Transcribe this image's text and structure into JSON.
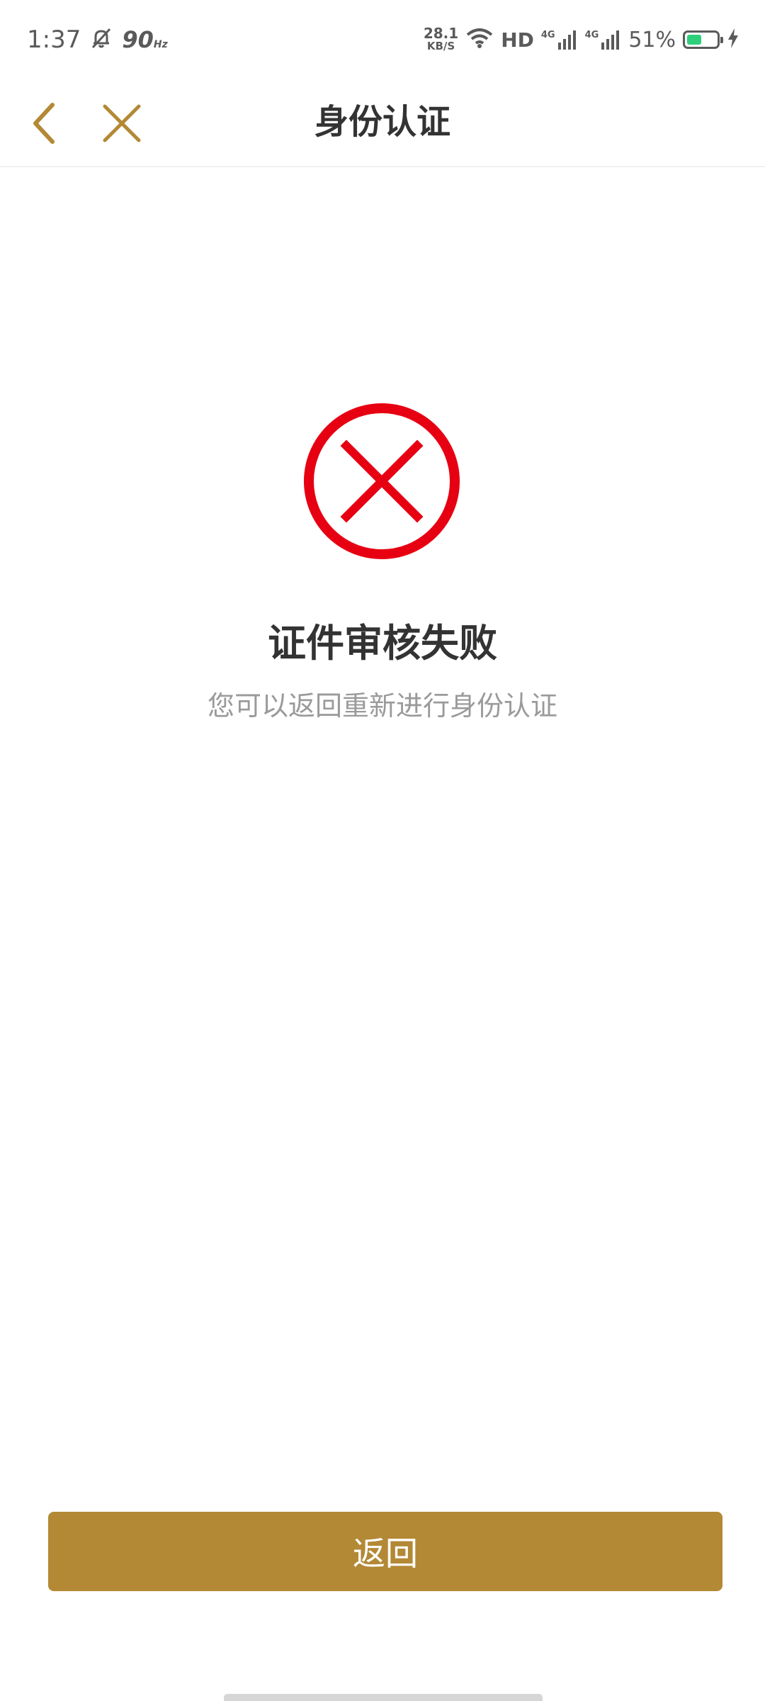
{
  "status_bar": {
    "time": "1:37",
    "refresh_rate": "90",
    "refresh_unit": "Hz",
    "net_speed_value": "28.1",
    "net_speed_unit": "KB/S",
    "hd_label": "HD",
    "signal_1_label": "4G",
    "signal_2_label": "4G",
    "battery_percent": "51%",
    "battery_level": 0.51,
    "icons": [
      "mute-bell-icon",
      "wifi-icon",
      "signal-icon",
      "signal-icon",
      "battery-icon",
      "charging-icon"
    ],
    "battery_color": "#2ecf7a"
  },
  "nav": {
    "title": "身份认证",
    "back_icon": "chevron-left-icon",
    "close_icon": "close-icon",
    "icon_color": "#b38935"
  },
  "result": {
    "icon": "error-circle-icon",
    "icon_color": "#e60012",
    "title": "证件审核失败",
    "subtitle": "您可以返回重新进行身份认证"
  },
  "actions": {
    "return_label": "返回",
    "button_color": "#b38935"
  }
}
